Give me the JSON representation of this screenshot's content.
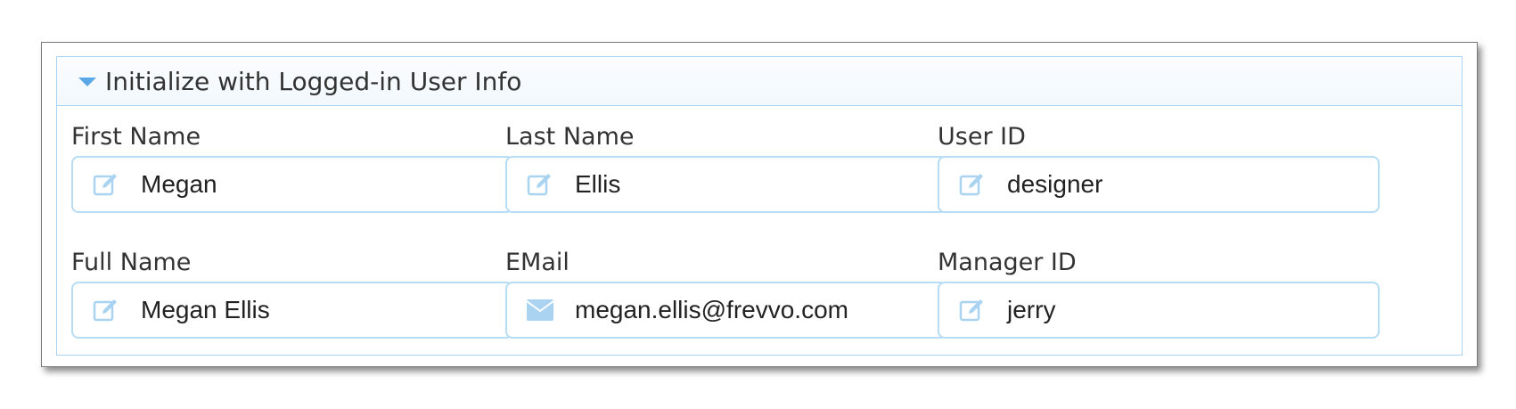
{
  "section": {
    "title": "Initialize with Logged-in User Info",
    "expanded": true
  },
  "fields": {
    "first_name": {
      "label": "First Name",
      "value": "Megan",
      "icon": "edit-icon"
    },
    "last_name": {
      "label": "Last Name",
      "value": "Ellis",
      "icon": "edit-icon"
    },
    "user_id": {
      "label": "User ID",
      "value": "designer",
      "icon": "edit-icon"
    },
    "full_name": {
      "label": "Full Name",
      "value": "Megan Ellis",
      "icon": "edit-icon"
    },
    "email": {
      "label": "EMail",
      "value": "megan.ellis@frevvo.com",
      "icon": "envelope-icon"
    },
    "manager_id": {
      "label": "Manager ID",
      "value": "jerry",
      "icon": "edit-icon"
    }
  },
  "colors": {
    "accent": "#5aa9e6",
    "field_border": "#b7dcf5",
    "section_border": "#a9d3f1",
    "text": "#333333"
  }
}
